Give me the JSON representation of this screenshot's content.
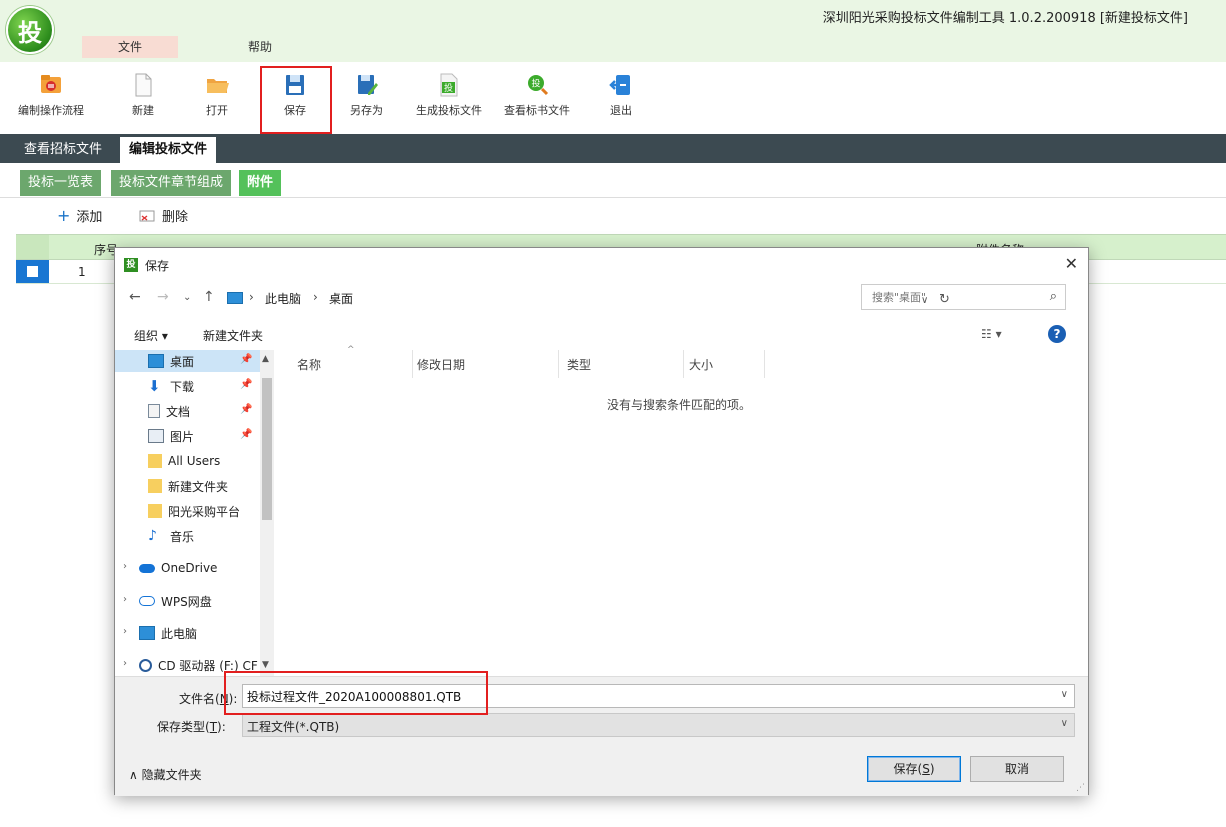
{
  "app": {
    "logo_char": "投",
    "title": "深圳阳光采购投标文件编制工具 1.0.2.200918 [新建投标文件]",
    "menu": {
      "file": "文件",
      "help": "帮助"
    }
  },
  "toolbar": {
    "workflow": "编制操作流程",
    "new": "新建",
    "open": "打开",
    "save": "保存",
    "save_as": "另存为",
    "generate": "生成投标文件",
    "view_tender": "查看标书文件",
    "exit": "退出",
    "generate_glyph": "投",
    "view_glyph": "投"
  },
  "tabs": {
    "view_tender_doc": "查看招标文件",
    "edit_bid_doc": "编辑投标文件"
  },
  "subtabs": {
    "bid_list": "投标一览表",
    "chapters": "投标文件章节组成",
    "attachments": "附件"
  },
  "actions": {
    "add": "添加",
    "delete": "删除"
  },
  "grid": {
    "col_seq": "序号",
    "col_name": "附件名称",
    "rows": [
      {
        "seq": "1"
      }
    ]
  },
  "dialog": {
    "icon_char": "投",
    "title": "保存",
    "address": {
      "pc": "此电脑",
      "desktop": "桌面"
    },
    "search_placeholder": "搜索\"桌面\"",
    "commands": {
      "organize": "组织 ▾",
      "new_folder": "新建文件夹"
    },
    "nav_items": [
      "桌面",
      "下载",
      "文档",
      "图片",
      "All Users",
      "新建文件夹",
      "阳光采购平台",
      "音乐",
      "OneDrive",
      "WPS网盘",
      "此电脑",
      "CD 驱动器 (F:) CF"
    ],
    "columns": {
      "name": "名称",
      "modified": "修改日期",
      "type": "类型",
      "size": "大小"
    },
    "empty_message": "没有与搜索条件匹配的项。",
    "filename_label": "文件名(N):",
    "filename_label_pre": "文件名(",
    "filename_label_key": "N",
    "filename_label_post": "):",
    "filename_value": "投标过程文件_2020A100008801.QTB",
    "filetype_label_pre": "保存类型(",
    "filetype_label_key": "T",
    "filetype_label_post": "):",
    "filetype_value": "工程文件(*.QTB)",
    "hide_folders": "隐藏文件夹",
    "save_pre": "保存(",
    "save_key": "S",
    "save_post": ")",
    "cancel": "取消"
  },
  "colors": {
    "accent_green": "#54c15a",
    "tab_dark": "#3c4a51",
    "highlight_red": "#e21f1f",
    "selection_blue": "#1976d2"
  }
}
